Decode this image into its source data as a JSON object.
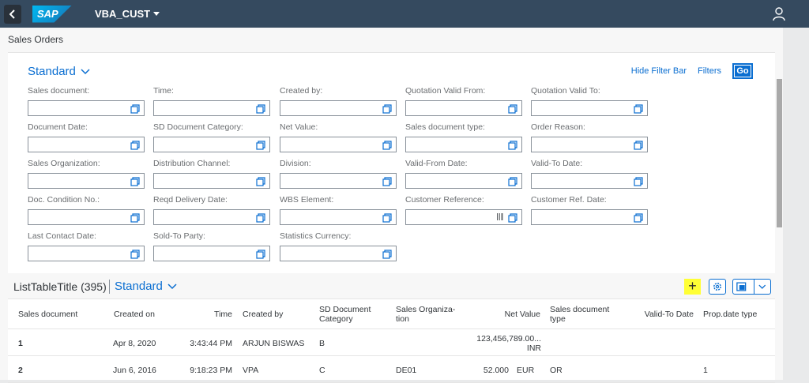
{
  "shell": {
    "back_icon": "chevron-left-icon",
    "logo": "SAP",
    "app_title": "VBA_CUST",
    "user_icon": "user-icon"
  },
  "page": {
    "title": "Sales Orders"
  },
  "filterbar": {
    "variant": "Standard",
    "hide_label": "Hide Filter Bar",
    "filters_label": "Filters",
    "go_label": "Go",
    "fields": [
      "Sales document:",
      "Time:",
      "Created by:",
      "Quotation Valid From:",
      "Quotation Valid To:",
      "Document Date:",
      "SD Document Category:",
      "Net Value:",
      "Sales document type:",
      "Order Reason:",
      "Sales Organization:",
      "Distribution Channel:",
      "Division:",
      "Valid-From Date:",
      "Valid-To Date:",
      "Doc. Condition No.:",
      "Reqd Delivery Date:",
      "WBS Element:",
      "Customer Reference:",
      "Customer Ref. Date:",
      "Last Contact Date:",
      "Sold-To Party:",
      "Statistics Currency:"
    ]
  },
  "table": {
    "title": "ListTableTitle (395)",
    "variant": "Standard",
    "add_icon": "+",
    "columns": [
      "Sales document",
      "Created on",
      "Time",
      "Created by",
      "SD Document Category",
      "Sales Organiza-tion",
      "Net Value",
      "Sales document type",
      "Valid-To Date",
      "Prop.date type"
    ],
    "rows": [
      {
        "doc": "1",
        "created_on": "Apr 8, 2020",
        "time": "3:43:44 PM",
        "created_by": "ARJUN BISWAS",
        "category": "B",
        "org": "",
        "net_value": "123,456,789.00...",
        "currency": "INR",
        "doc_type": "",
        "valid_to": "",
        "prop": ""
      },
      {
        "doc": "2",
        "created_on": "Jun 6, 2016",
        "time": "9:18:23 PM",
        "created_by": "VPA",
        "category": "C",
        "org": "DE01",
        "net_value": "52.000",
        "currency": "EUR",
        "doc_type": "OR",
        "valid_to": "",
        "prop": "1"
      }
    ]
  }
}
